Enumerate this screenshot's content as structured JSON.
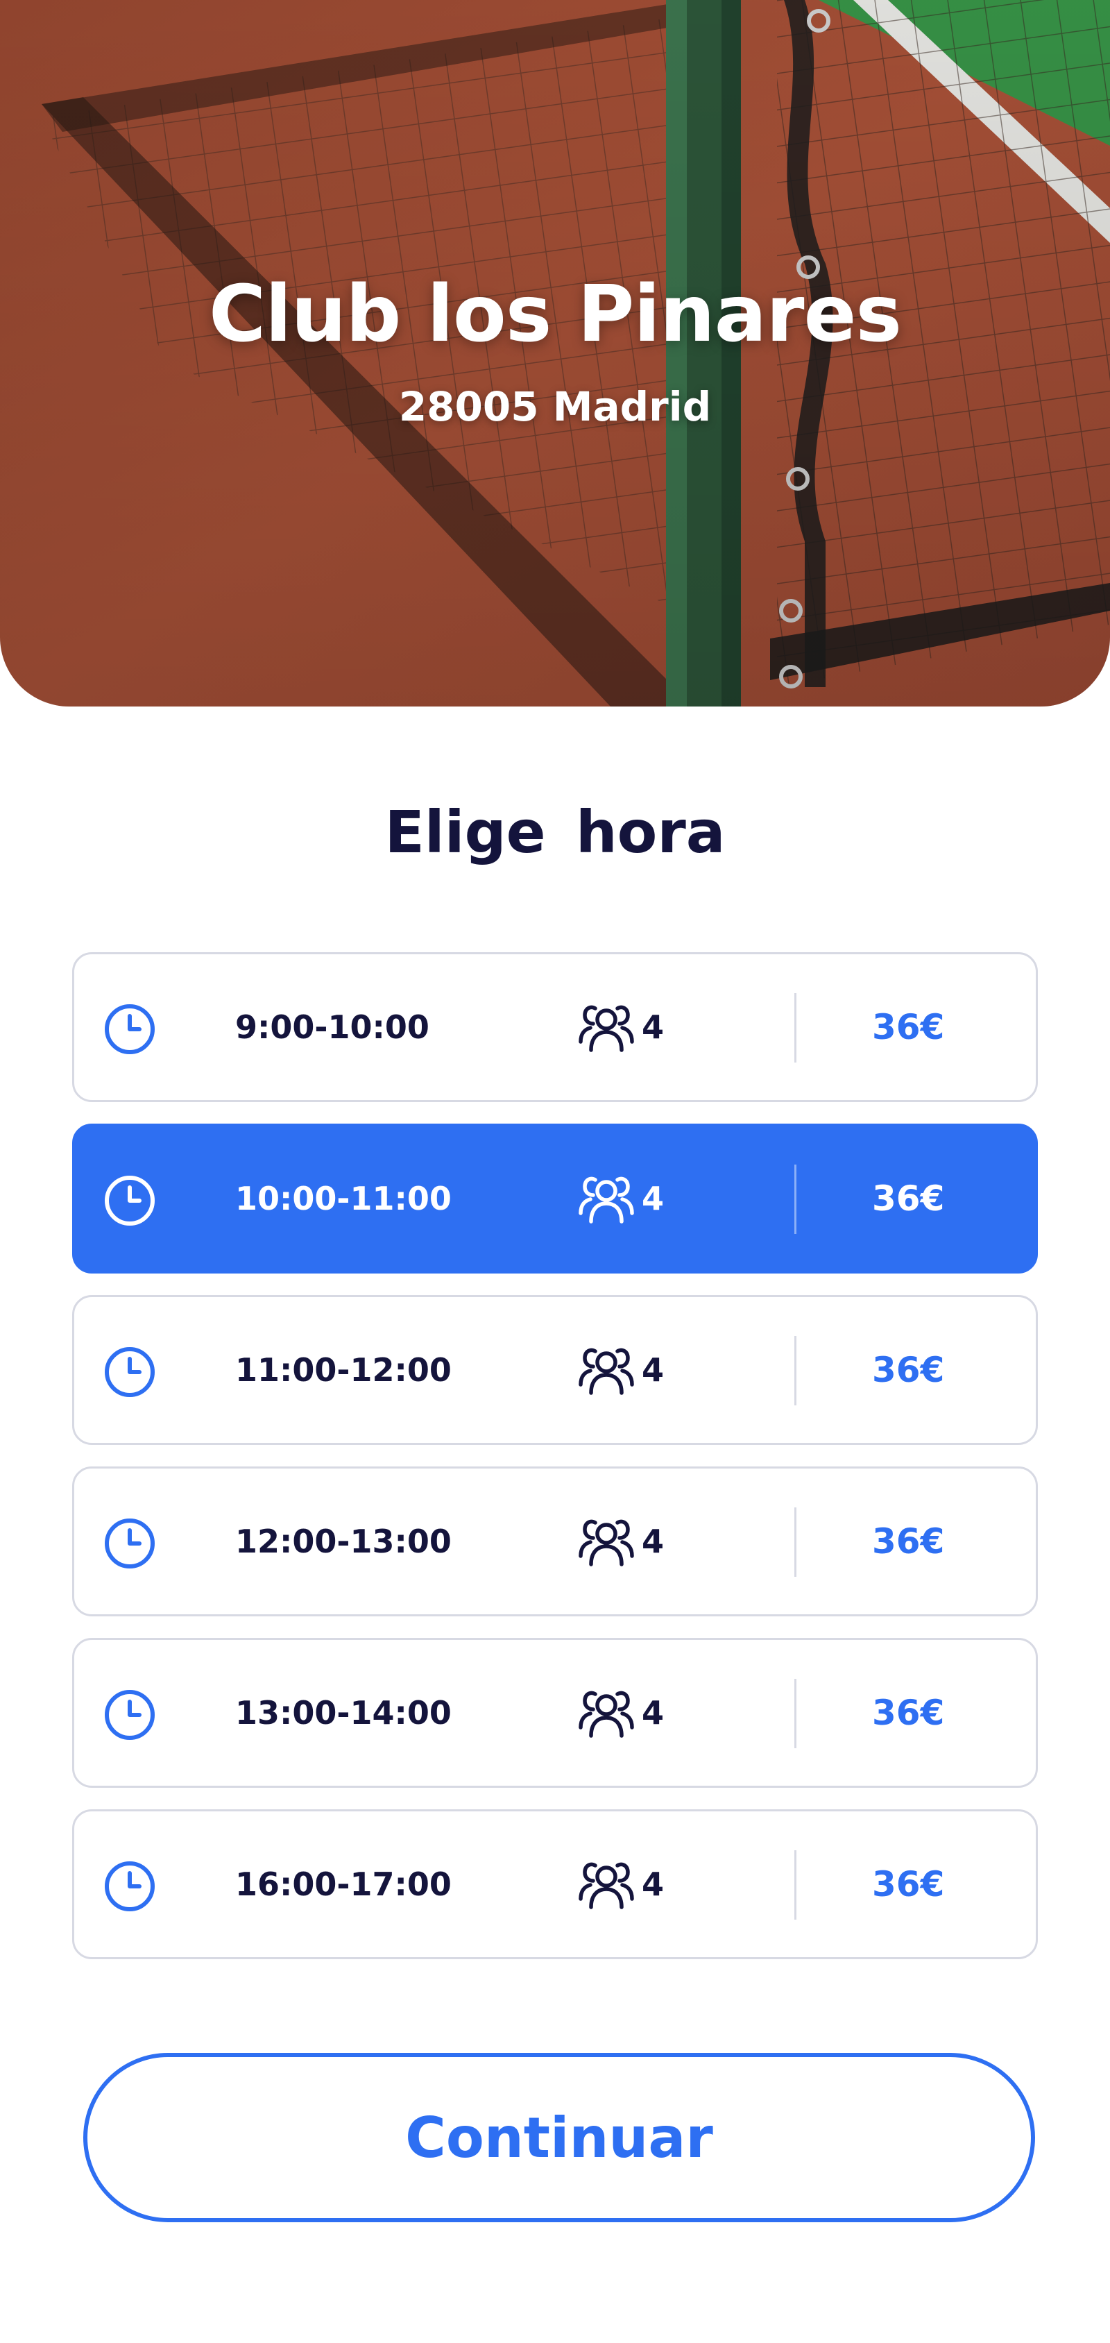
{
  "hero": {
    "title": "Club los Pinares",
    "subtitle": "28005 Madrid"
  },
  "section": {
    "title": "Elige  hora"
  },
  "slots": [
    {
      "time": "9:00-10:00",
      "players": "4",
      "price": "36€",
      "selected": false
    },
    {
      "time": "10:00-11:00",
      "players": "4",
      "price": "36€",
      "selected": true
    },
    {
      "time": "11:00-12:00",
      "players": "4",
      "price": "36€",
      "selected": false
    },
    {
      "time": "12:00-13:00",
      "players": "4",
      "price": "36€",
      "selected": false
    },
    {
      "time": "13:00-14:00",
      "players": "4",
      "price": "36€",
      "selected": false
    },
    {
      "time": "16:00-17:00",
      "players": "4",
      "price": "36€",
      "selected": false
    }
  ],
  "icons": {
    "time": "clock-icon",
    "players": "people-icon"
  },
  "actions": {
    "continue_label": "Continuar"
  },
  "colors": {
    "accent": "#2e6ff2",
    "text_dark": "#14143c",
    "border": "#d7d9e3",
    "court_clay": "#b0553a",
    "court_green": "#3a9a4a"
  }
}
